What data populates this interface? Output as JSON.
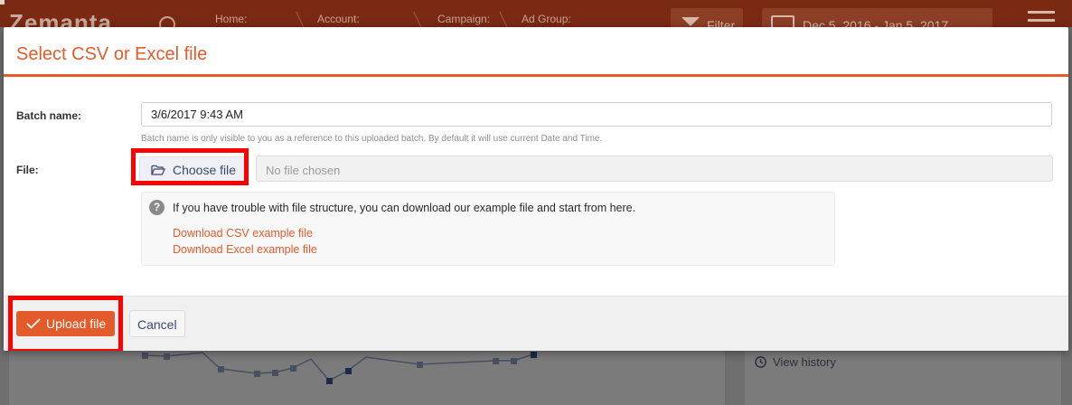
{
  "app": {
    "logo": "Zemanta",
    "breadcrumbs": [
      "Home:",
      "Account:",
      "Campaign:",
      "Ad Group:"
    ],
    "filter_label": "Filter",
    "date_range": "Dec 5, 2016 - Jan 5, 2017",
    "view_history": "View history"
  },
  "modal": {
    "title": "Select CSV or Excel file",
    "batch_label": "Batch name:",
    "batch_value": "3/6/2017 9:43 AM",
    "batch_help": "Batch name is only visible to you as a reference to this uploaded batch. By default it will use current Date and Time.",
    "file_label": "File:",
    "choose_file": "Choose file",
    "no_file": "No file chosen",
    "info_text": "If you have trouble with file structure, you can download our example file and start from here.",
    "download_csv": "Download CSV example file",
    "download_excel": "Download Excel example file",
    "upload_label": "Upload file",
    "cancel_label": "Cancel"
  },
  "colors": {
    "accent": "#e45b2b",
    "highlight": "#ff0000"
  }
}
